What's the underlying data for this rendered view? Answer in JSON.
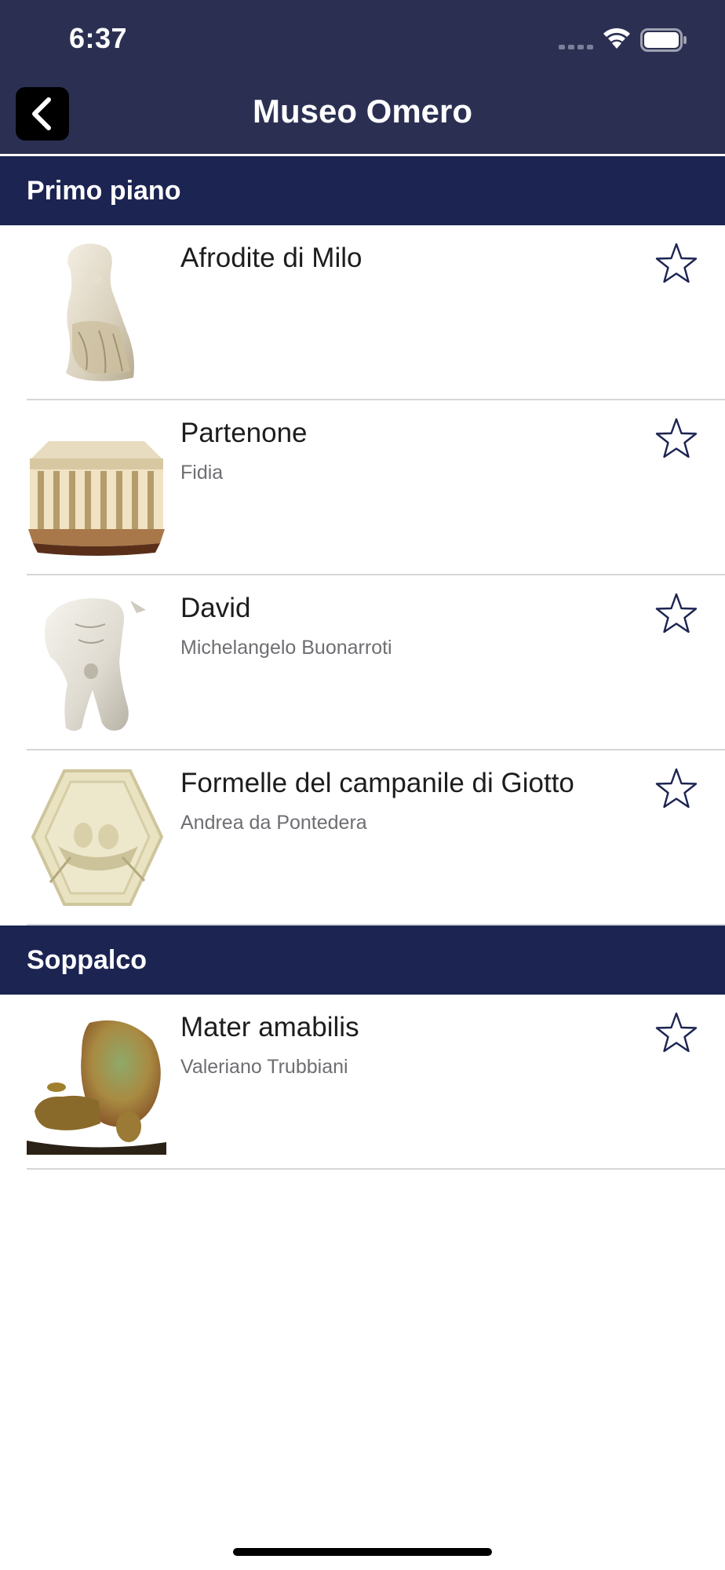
{
  "status_bar": {
    "time": "6:37"
  },
  "nav": {
    "title": "Museo Omero",
    "back_icon": "chevron-left-icon"
  },
  "sections": [
    {
      "title": "Primo piano",
      "items": [
        {
          "title": "Afrodite di Milo",
          "subtitle": "",
          "image": "venus-statue"
        },
        {
          "title": "Partenone",
          "subtitle": "Fidia",
          "image": "parthenon-model"
        },
        {
          "title": "David",
          "subtitle": "Michelangelo Buonarroti",
          "image": "david-statue"
        },
        {
          "title": "Formelle del campanile di Giotto",
          "subtitle": "Andrea da Pontedera",
          "image": "hexagonal-relief"
        }
      ]
    },
    {
      "title": "Soppalco",
      "items": [
        {
          "title": "Mater amabilis",
          "subtitle": "Valeriano Trubbiani",
          "image": "bronze-sculpture"
        }
      ]
    }
  ],
  "colors": {
    "nav_background": "#2b3053",
    "section_background": "#1c2452",
    "star_outline": "#1c2452"
  }
}
